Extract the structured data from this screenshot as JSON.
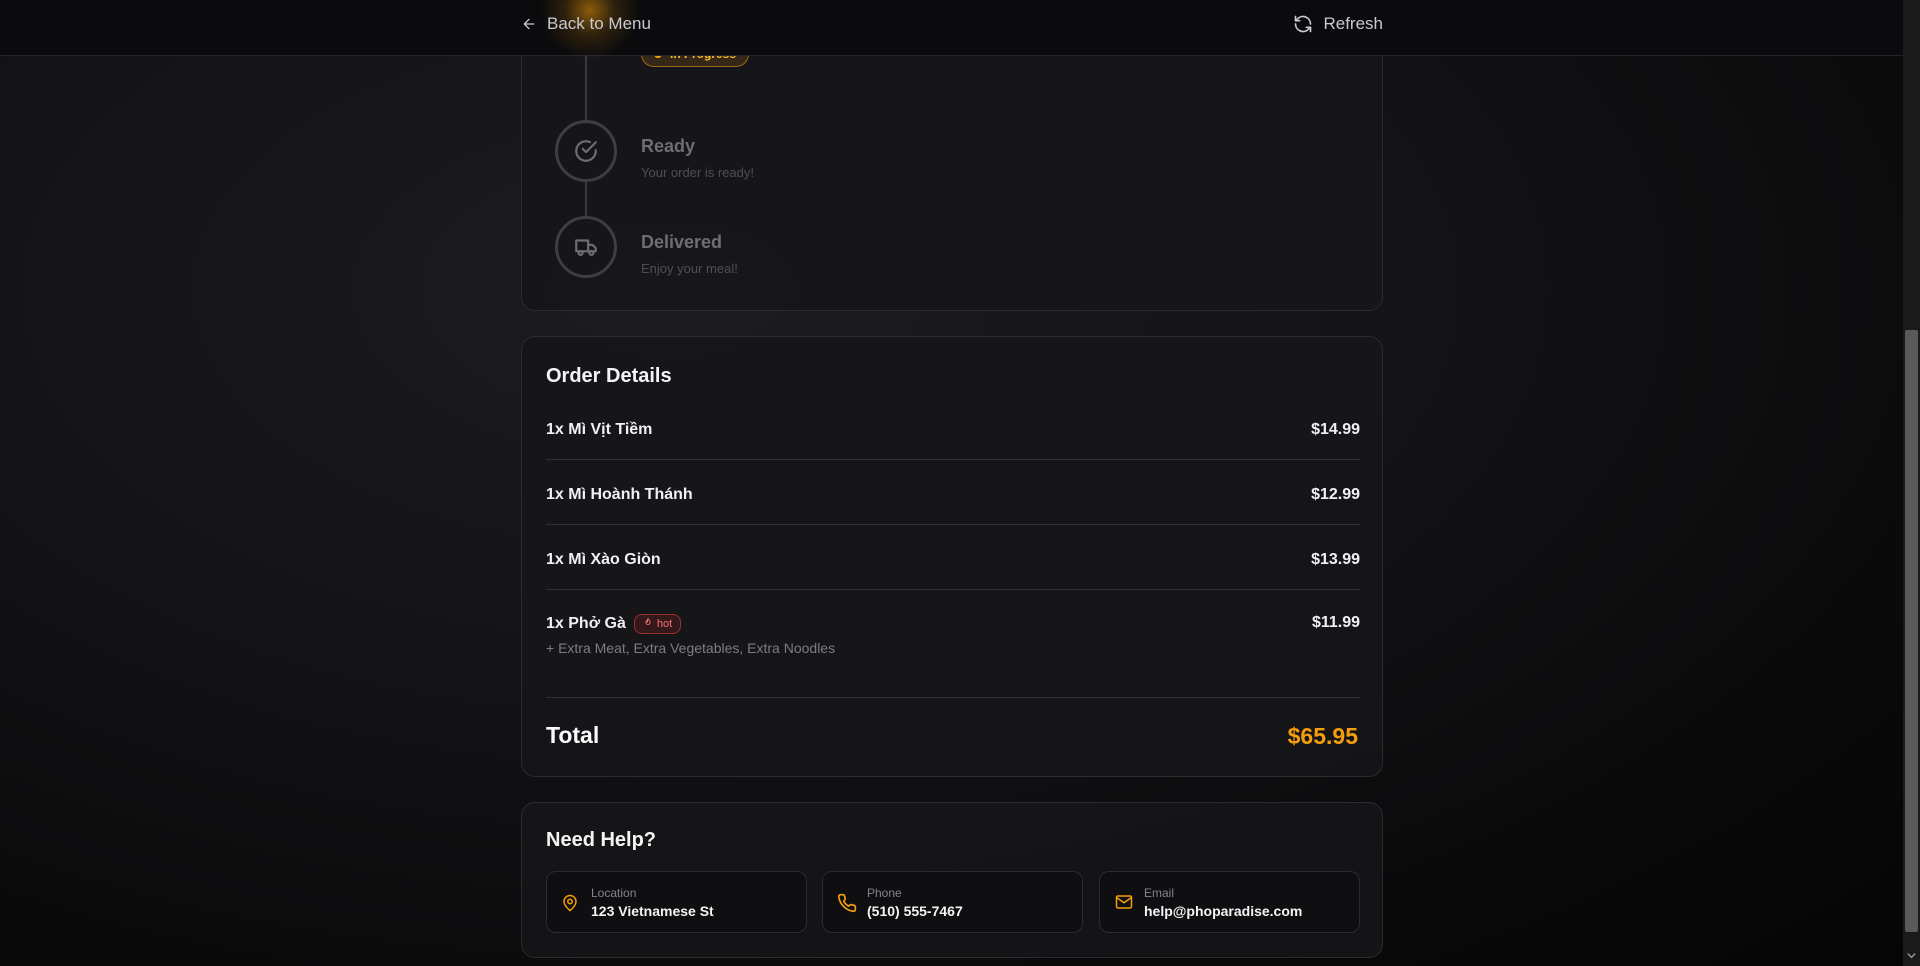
{
  "header": {
    "back_label": "Back to Menu",
    "refresh_label": "Refresh"
  },
  "status": {
    "current_badge": "In Progress",
    "steps": [
      {
        "title": "Ready",
        "subtitle": "Your order is ready!",
        "icon": "check-circle-icon"
      },
      {
        "title": "Delivered",
        "subtitle": "Enjoy your meal!",
        "icon": "truck-icon"
      }
    ]
  },
  "order": {
    "title": "Order Details",
    "items": [
      {
        "name": "1x Mì Vịt Tiềm",
        "price": "$14.99"
      },
      {
        "name": "1x Mì Hoành Thánh",
        "price": "$12.99"
      },
      {
        "name": "1x Mì Xào Giòn",
        "price": "$13.99"
      },
      {
        "name": "1x Phở Gà",
        "price": "$11.99",
        "tag": "hot",
        "extras": "+ Extra Meat, Extra Vegetables, Extra Noodles"
      }
    ],
    "total_label": "Total",
    "total_value": "$65.95"
  },
  "help": {
    "title": "Need Help?",
    "contacts": [
      {
        "label": "Location",
        "value": "123 Vietnamese St",
        "icon": "map-pin-icon"
      },
      {
        "label": "Phone",
        "value": "(510) 555-7467",
        "icon": "phone-icon"
      },
      {
        "label": "Email",
        "value": "help@phoparadise.com",
        "icon": "mail-icon"
      }
    ]
  },
  "colors": {
    "accent": "#f59e0b",
    "hot": "#f87171",
    "background": "#0a0a0b"
  }
}
